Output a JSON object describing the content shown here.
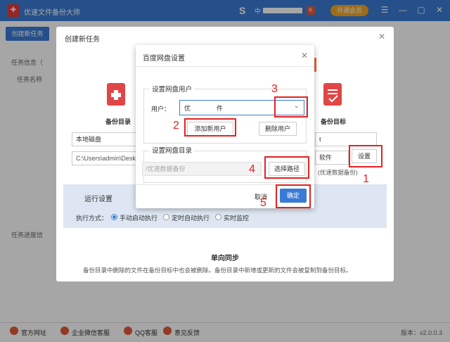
{
  "app": {
    "title": "优速文件备份大师",
    "user_initial": "S",
    "user_prefix": "中",
    "badge": "K",
    "vip_label": "开通会员",
    "create_task_btn": "创建新任务",
    "task_info_label": "任务信息（",
    "task_name_label": "任务名称",
    "progress_label": "任务进度信",
    "controls": [
      "☰",
      "—",
      "▢",
      "✕"
    ]
  },
  "create_dialog": {
    "title": "创建新任务",
    "backup_dir": {
      "label": "备份目录",
      "select": "本地磁盘",
      "path": "C:\\Users\\admin\\Desk"
    },
    "backup_target": {
      "label": "备份目标",
      "select": "t",
      "select2": "软件",
      "set_btn": "设置",
      "hint": "(优速数据备份)"
    },
    "run_settings": {
      "title": "运行设置",
      "mode_label": "执行方式：",
      "options": [
        "手动启动执行",
        "定时自动执行",
        "实时监控"
      ],
      "selected": 0
    },
    "sync_title": "单向同步",
    "sync_desc": "备份目录中删除的文件在备份目标中也会被删除。备份目录中新增或更新的文件会被复制到备份目标。"
  },
  "baidu_dialog": {
    "title": "百度网盘设置",
    "user_section": "设置网盘用户",
    "user_label": "用户：",
    "user_value_a": "优",
    "user_value_b": "件",
    "add_user_btn": "添加新用户",
    "delete_user_btn": "删除用户",
    "dir_section": "设置网盘目录",
    "dir_placeholder": "/优速数据备份",
    "choose_path_btn": "选择路径",
    "cancel_btn": "取消",
    "confirm_btn": "确定"
  },
  "annotations": [
    "1",
    "2",
    "3",
    "4",
    "5"
  ],
  "footer": {
    "items": [
      "官方网址",
      "企业微信客服",
      "QQ客服",
      "意见反馈"
    ],
    "version": "版本：v2.0.0.3"
  },
  "colors": {
    "primary": "#3a7bd5",
    "annotation": "#e52222",
    "accent": "#e8643a"
  }
}
